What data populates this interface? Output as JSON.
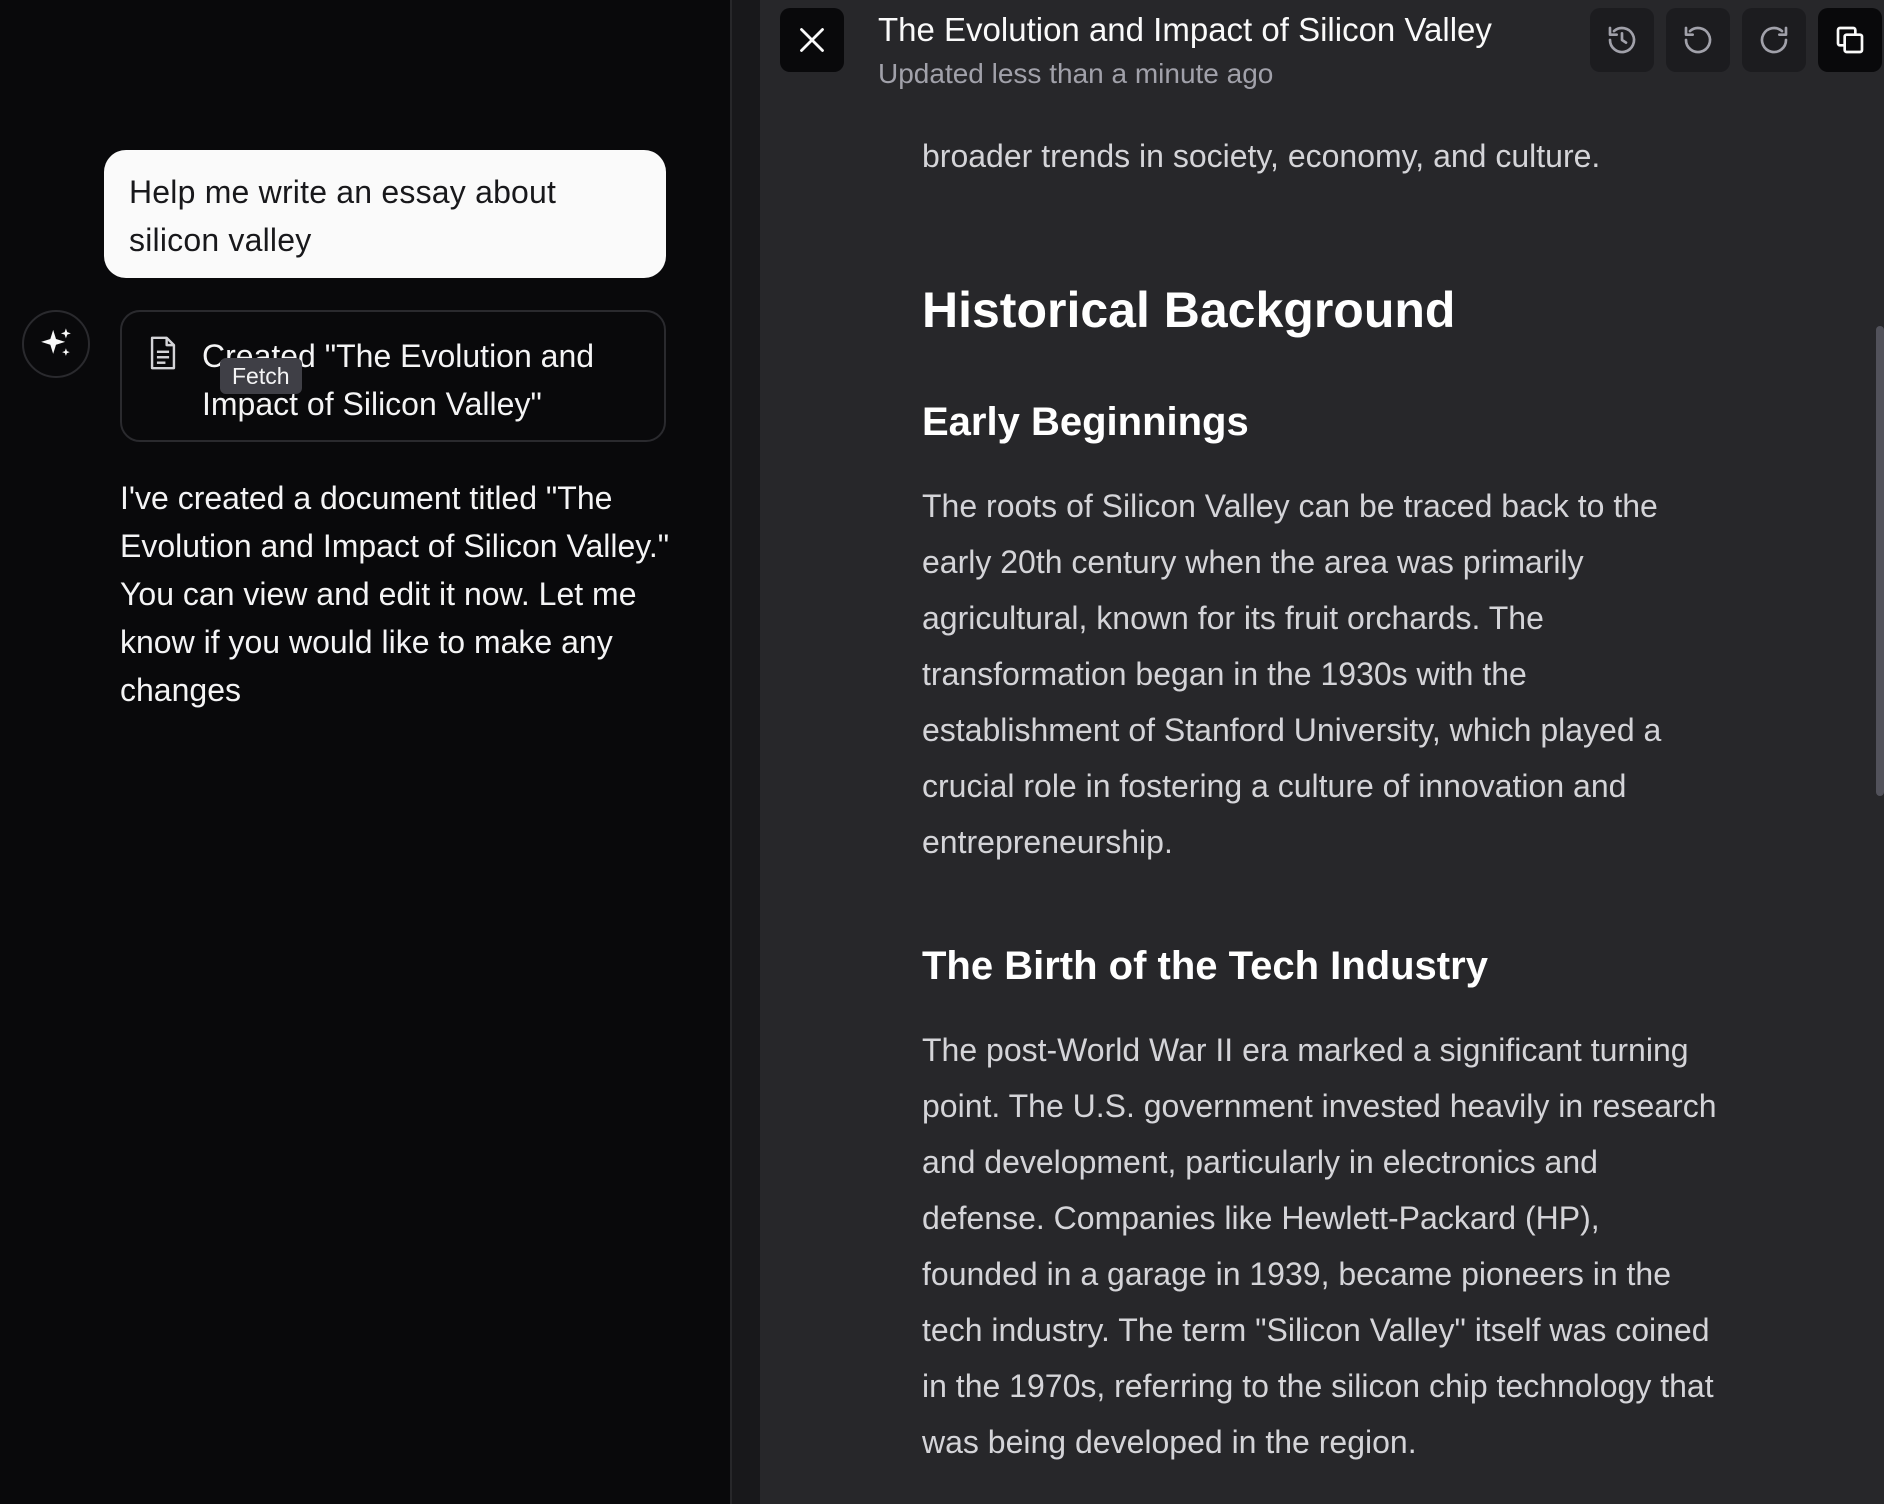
{
  "chat": {
    "user_message": "Help me write an essay about silicon valley",
    "doc_card_title": "Created \"The Evolution and Impact of Silicon Valley\"",
    "tooltip": "Fetch",
    "assistant_message": "I've created a document titled \"The Evolution and Impact of Silicon Valley.\" You can view and edit it now. Let me know if you would like to make any changes"
  },
  "document": {
    "title": "The Evolution and Impact of Silicon Valley",
    "status": "Updated less than a minute ago",
    "toolbar": {
      "close_icon": "close-icon",
      "history_icon": "history-icon",
      "undo_icon": "undo-icon",
      "redo_icon": "redo-icon",
      "copy_icon": "copy-icon"
    },
    "content": {
      "intro_tail": "broader trends in society, economy, and culture.",
      "h2_historical": "Historical Background",
      "h3_early": "Early Beginnings",
      "p_early": "The roots of Silicon Valley can be traced back to the early 20th century when the area was primarily agricultural, known for its fruit orchards. The transformation began in the 1930s with the establishment of Stanford University, which played a crucial role in fostering a culture of innovation and entrepreneurship.",
      "h3_birth": "The Birth of the Tech Industry",
      "p_birth": "The post-World War II era marked a significant turning point. The U.S. government invested heavily in research and development, particularly in electronics and defense. Companies like Hewlett-Packard (HP), founded in a garage in 1939, became pioneers in the tech industry. The term \"Silicon Valley\" itself was coined in the 1970s, referring to the silicon chip technology that was being developed in the region."
    }
  },
  "colors": {
    "chat_bg": "#09090b",
    "doc_bg": "#27272a",
    "user_bubble": "#fafafa",
    "heading_text": "#ffffff",
    "body_text": "#d4d4d8",
    "muted_text": "#a1a1aa"
  }
}
